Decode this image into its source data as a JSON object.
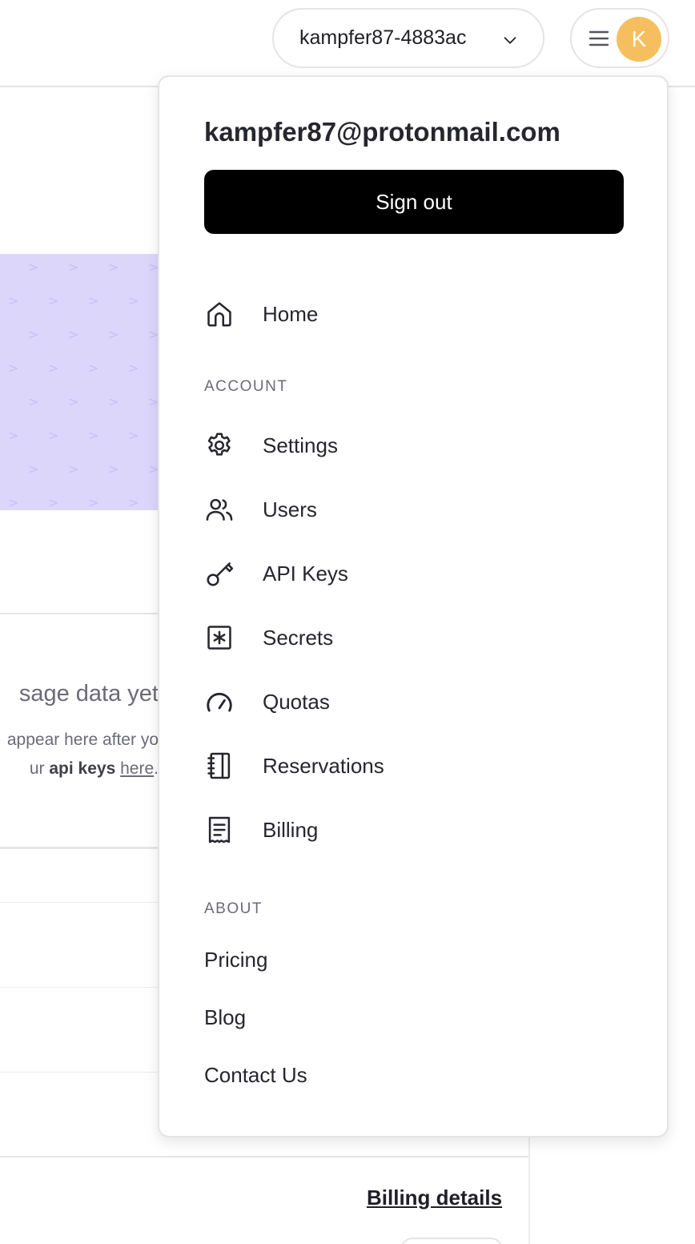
{
  "header": {
    "org_name": "kampfer87-4883ac",
    "avatar_initial": "K",
    "avatar_color": "#f5bf60"
  },
  "background": {
    "empty_title": "sage data yet",
    "empty_desc_line1": "appear here after yo",
    "empty_desc_line2_prefix": "ur ",
    "empty_desc_bold": "api keys",
    "empty_desc_link": "here",
    "empty_desc_suffix": ".",
    "billing_link": "Billing details",
    "hero_color": "#ddd6fb"
  },
  "dropdown": {
    "email": "kampfer87@protonmail.com",
    "sign_out": "Sign out",
    "home": {
      "label": "Home",
      "icon": "home-icon"
    },
    "account_section": "ACCOUNT",
    "account_items": [
      {
        "label": "Settings",
        "icon": "gear-icon"
      },
      {
        "label": "Users",
        "icon": "users-icon"
      },
      {
        "label": "API Keys",
        "icon": "key-icon"
      },
      {
        "label": "Secrets",
        "icon": "asterisk-box-icon"
      },
      {
        "label": "Quotas",
        "icon": "gauge-icon"
      },
      {
        "label": "Reservations",
        "icon": "notebook-icon"
      },
      {
        "label": "Billing",
        "icon": "receipt-icon"
      }
    ],
    "about_section": "ABOUT",
    "about_items": [
      "Pricing",
      "Blog",
      "Contact Us"
    ]
  }
}
